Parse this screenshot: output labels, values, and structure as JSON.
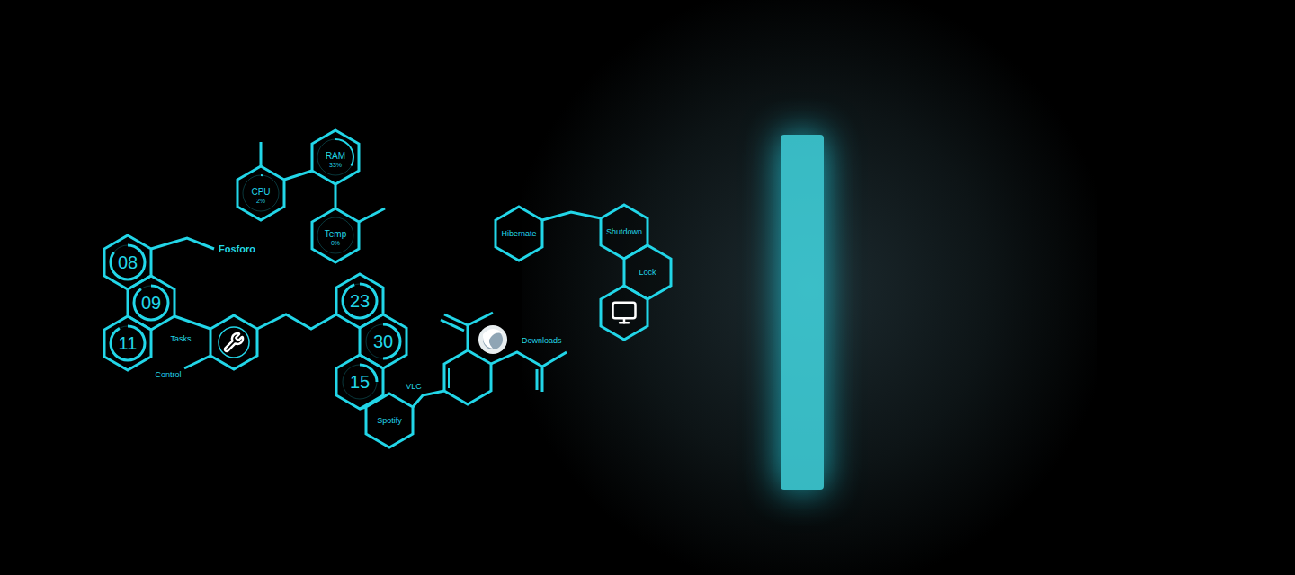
{
  "system_meters": [
    {
      "label": "CPU",
      "reading": "2%",
      "level": 0.02
    },
    {
      "label": "RAM",
      "reading": "33%",
      "level": 0.33
    },
    {
      "label": "Temp",
      "reading": "0%",
      "level": 0
    }
  ],
  "date": {
    "label": "Fosforo",
    "fields": [
      {
        "value": "08",
        "level": 0.85
      },
      {
        "value": "09",
        "level": 0.9
      },
      {
        "value": "11",
        "level": 0.92
      }
    ]
  },
  "clock": [
    {
      "value": "23",
      "level": 0.95
    },
    {
      "value": "30",
      "level": 0.5
    },
    {
      "value": "15",
      "level": 0.25
    }
  ],
  "launchers": [
    {
      "label": "Tasks"
    },
    {
      "label": "Control"
    },
    {
      "label": "VLC"
    },
    {
      "label": "Spotify"
    },
    {
      "label": "Downloads"
    }
  ],
  "power": [
    {
      "label": "Hibernate"
    },
    {
      "label": "Shutdown"
    },
    {
      "label": "Lock"
    }
  ]
}
